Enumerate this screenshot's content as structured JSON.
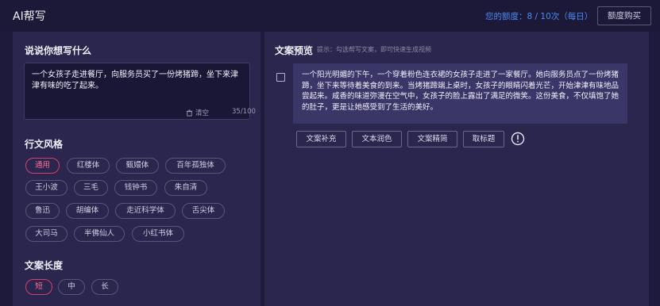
{
  "header": {
    "title": "AI帮写",
    "quota_text": "您的额度：8 / 10次（每日）",
    "buy_label": "额度购买"
  },
  "left": {
    "prompt_title": "说说你想写什么",
    "prompt_value": "一个女孩子走进餐厅，向服务员买了一份烤猪蹄，坐下来津津有味的吃了起来。",
    "clear_label": "清空",
    "char_count": "35/100",
    "style_title": "行文风格",
    "styles": [
      {
        "label": "通用",
        "active": true
      },
      {
        "label": "红楼体",
        "active": false
      },
      {
        "label": "甄嬛体",
        "active": false
      },
      {
        "label": "百年孤独体",
        "active": false
      },
      {
        "label": "王小波",
        "active": false
      },
      {
        "label": "三毛",
        "active": false
      },
      {
        "label": "钱钟书",
        "active": false
      },
      {
        "label": "朱自清",
        "active": false
      },
      {
        "label": "鲁迅",
        "active": false
      },
      {
        "label": "胡编体",
        "active": false
      },
      {
        "label": "走近科学体",
        "active": false
      },
      {
        "label": "舌尖体",
        "active": false
      },
      {
        "label": "大司马",
        "active": false
      },
      {
        "label": "半佛仙人",
        "active": false
      },
      {
        "label": "小红书体",
        "active": false
      }
    ],
    "length_title": "文案长度",
    "lengths": [
      {
        "label": "短",
        "active": true
      },
      {
        "label": "中",
        "active": false
      },
      {
        "label": "长",
        "active": false
      }
    ]
  },
  "right": {
    "preview_title": "文案预览",
    "hint": "提示：勾选帮写文案，即可快速生成视频",
    "copy_text": "一个阳光明媚的下午，一个穿着粉色连衣裙的女孩子走进了一家餐厅。她向服务员点了一份烤猪蹄，坐下来等待着美食的到来。当烤猪蹄端上桌时，女孩子的眼睛闪着光芒，开始津津有味地品尝起来。咸香的味道弥漫在空气中，女孩子的脸上露出了满足的微笑。这份美食，不仅填饱了她的肚子，更是让她感受到了生活的美好。",
    "actions": [
      {
        "label": "文案补充"
      },
      {
        "label": "文本润色"
      },
      {
        "label": "文案精简"
      },
      {
        "label": "取标题"
      }
    ]
  },
  "colors": {
    "background": "#1d1a3c",
    "panel": "#2a264d",
    "accent_active": "#d8406a",
    "quota_blue": "#4f8cf0",
    "card": "#3a3668"
  },
  "icons": {
    "clear": "trash-icon",
    "info": "info-circle-icon",
    "checkbox": "checkbox-icon"
  }
}
